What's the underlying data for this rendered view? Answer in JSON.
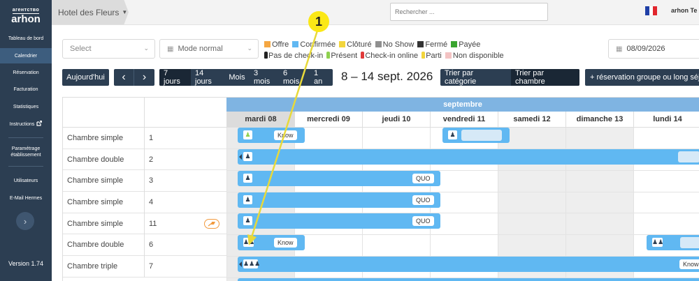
{
  "sidebar": {
    "logo_small": "агентство",
    "logo_main": "arhon",
    "items": [
      {
        "label": "Tableau de bord",
        "active": false
      },
      {
        "label": "Calendrier",
        "active": true
      },
      {
        "label": "Réservation",
        "active": false
      },
      {
        "label": "Facturation",
        "active": false
      },
      {
        "label": "Statistiques",
        "active": false
      },
      {
        "label": "Instructions",
        "active": false,
        "icon": "external-link-icon"
      },
      {
        "label": "Paramétrage établissement",
        "active": false
      },
      {
        "label": "Utilisateurs",
        "active": false
      },
      {
        "label": "E-Mail Hermes",
        "active": false
      }
    ],
    "toggle_icon": "chevron-right-icon",
    "version": "Version 1.74"
  },
  "topbar": {
    "hotel": "Hotel des Fleurs",
    "search_placeholder": "Rechercher ...",
    "user": "arhon Te"
  },
  "filters": {
    "select_placeholder": "Select",
    "mode": "Mode normal",
    "date": "08/09/2026"
  },
  "legend": {
    "row1": [
      {
        "label": "Offre",
        "color": "#f5a742"
      },
      {
        "label": "Confirmée",
        "color": "#60b8f2"
      },
      {
        "label": "Clôturé",
        "color": "#f2d53c"
      },
      {
        "label": "No Show",
        "color": "#8f8f8f"
      },
      {
        "label": "Fermé",
        "color": "#333333"
      },
      {
        "label": "Payée",
        "color": "#3aa52f"
      }
    ],
    "row2": [
      {
        "label": "Pas de check-in",
        "color": "#222222",
        "kind": "person"
      },
      {
        "label": "Présent",
        "color": "#8fd14f",
        "kind": "person"
      },
      {
        "label": "Check-in online",
        "color": "#e03a3a",
        "kind": "person"
      },
      {
        "label": "Parti",
        "color": "#f2d53c",
        "kind": "person"
      },
      {
        "label": "Non disponible",
        "color": "#f3c3c3",
        "kind": "swatch"
      }
    ]
  },
  "toolbar": {
    "today": "Aujourd'hui",
    "prev_icon": "chevron-left-icon",
    "next_icon": "chevron-right-icon",
    "ranges": [
      "7 jours",
      "14 jours",
      "Mois",
      "3 mois",
      "6 mois",
      "1 an"
    ],
    "active_range": "7 jours",
    "date_range": "8 – 14 sept. 2026",
    "sort_category": "Trier par catégorie",
    "sort_room": "Trier par chambre",
    "add_group": "+ réservation groupe ou long séjo"
  },
  "calendar": {
    "month": "septembre",
    "days": [
      "mardi 08",
      "mercredi 09",
      "jeudi 10",
      "vendredi 11",
      "samedi 12",
      "dimanche 13",
      "lundi 14"
    ],
    "rooms": [
      {
        "type": "Chambre simple",
        "number": "1"
      },
      {
        "type": "Chambre double",
        "number": "2"
      },
      {
        "type": "Chambre simple",
        "number": "3"
      },
      {
        "type": "Chambre simple",
        "number": "4"
      },
      {
        "type": "Chambre simple",
        "number": "11",
        "cleaning_icon": "broom-icon"
      },
      {
        "type": "Chambre double",
        "number": "6"
      },
      {
        "type": "Chambre triple",
        "number": "7"
      }
    ],
    "tags": {
      "know": "Know",
      "quo": "QUO"
    }
  },
  "annotation": {
    "number": "1",
    "color": "#fbe816"
  }
}
